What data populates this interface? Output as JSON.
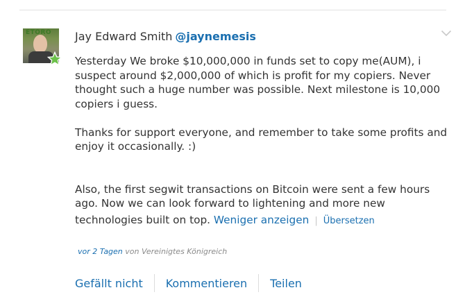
{
  "post": {
    "author": {
      "name": "Jay Edward Smith",
      "handle": "@jaynemesis",
      "avatar_logo_text": "ETORO"
    },
    "body": {
      "paragraph_1": "Yesterday We broke $10,000,000 in funds set to copy me(AUM), i suspect around $2,000,000 of which is profit for my copiers. Never thought such a huge number was possible. Next milestone is 10,000 copiers i guess.",
      "paragraph_2": "Thanks for support everyone, and remember to take some profits and enjoy it occasionally. :)",
      "paragraph_3_lead": "Also, the first segwit transactions on Bitcoin were sent a few hours ago. Now we can look forward to lightening and more new technologies",
      "paragraph_3_tail": "built on top.",
      "show_less": "Weniger anzeigen",
      "separator": "|",
      "translate": "Übersetzen"
    },
    "meta": {
      "time": "vor 2 Tagen",
      "location": "von Vereinigtes Königreich"
    },
    "actions": {
      "dislike": "Gefällt nicht",
      "comment": "Kommentieren",
      "share": "Teilen"
    },
    "colors": {
      "link": "#1a6fb0",
      "text": "#333333",
      "badge": "#6cc04a"
    },
    "icons": {
      "badge": "star-icon",
      "menu": "chevron-down-icon"
    }
  }
}
